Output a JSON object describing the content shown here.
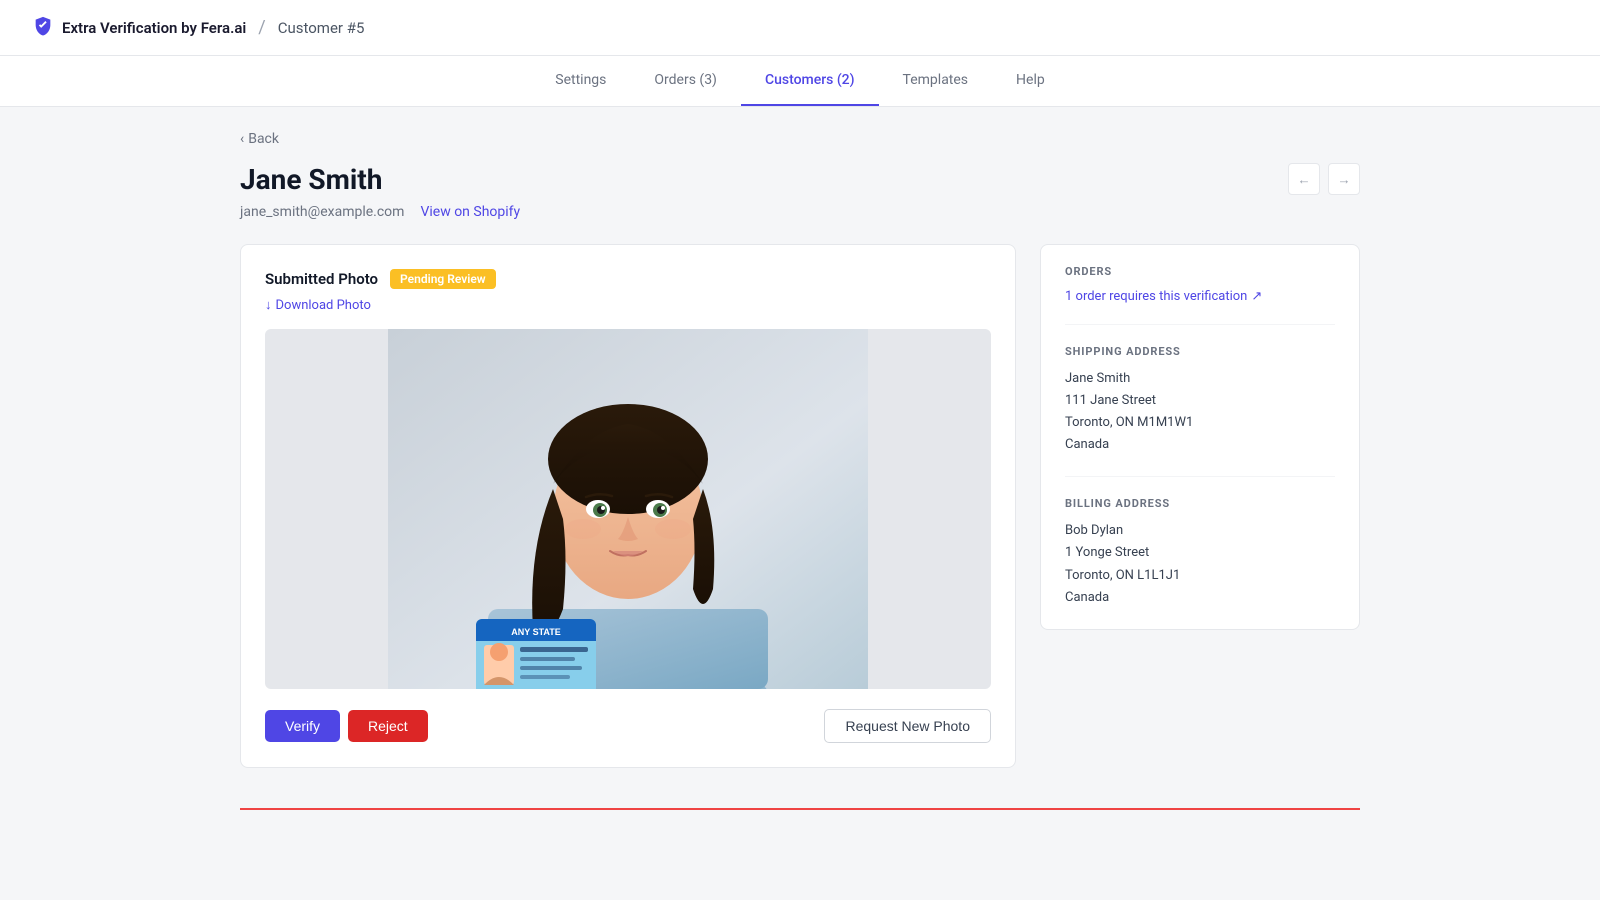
{
  "app": {
    "brand": "Extra Verification by Fera.ai",
    "shield_icon": "shield",
    "divider": "/",
    "breadcrumb": "Customer #5"
  },
  "nav": {
    "items": [
      {
        "label": "Settings",
        "active": false
      },
      {
        "label": "Orders (3)",
        "active": false
      },
      {
        "label": "Customers (2)",
        "active": true
      },
      {
        "label": "Templates",
        "active": false
      },
      {
        "label": "Help",
        "active": false
      }
    ]
  },
  "page": {
    "back_label": "Back",
    "customer_name": "Jane Smith",
    "customer_email": "jane_smith@example.com",
    "view_shopify_label": "View on Shopify",
    "prev_arrow": "←",
    "next_arrow": "→"
  },
  "photo_card": {
    "title": "Submitted Photo",
    "badge": "Pending Review",
    "download_label": "Download Photo",
    "verify_label": "Verify",
    "reject_label": "Reject",
    "request_label": "Request New Photo"
  },
  "orders": {
    "section_title": "ORDERS",
    "link_text": "1 order requires this verification",
    "external_icon": "external-link"
  },
  "shipping": {
    "section_title": "SHIPPING ADDRESS",
    "name": "Jane Smith",
    "street": "111 Jane Street",
    "city_state": "Toronto, ON M1M1W1",
    "country": "Canada"
  },
  "billing": {
    "section_title": "BILLING ADDRESS",
    "name": "Bob Dylan",
    "street": "1 Yonge Street",
    "city_state": "Toronto, ON L1L1J1",
    "country": "Canada"
  },
  "colors": {
    "accent": "#4f46e5",
    "verify": "#4f46e5",
    "reject": "#dc2626",
    "pending_badge": "#fbbf24"
  }
}
